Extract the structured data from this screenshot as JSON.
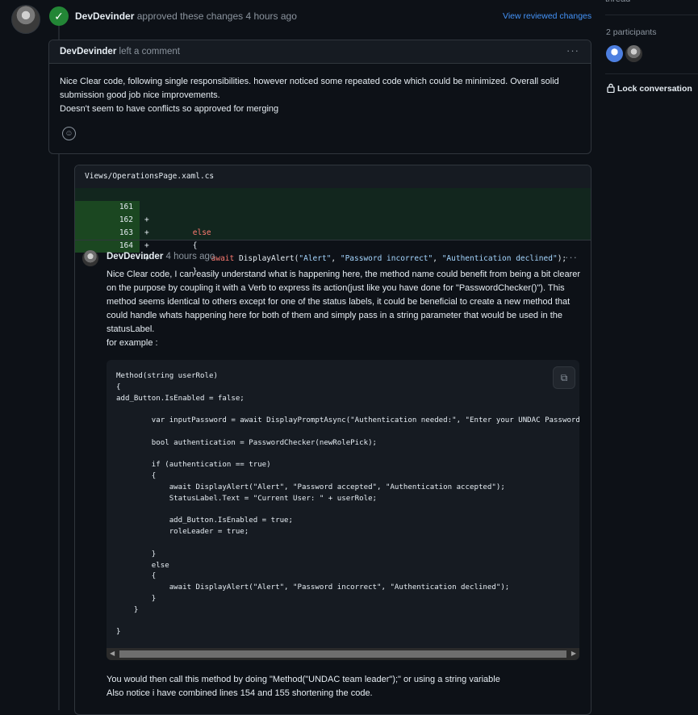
{
  "event": {
    "author": "DevDevinder",
    "action": "approved these changes",
    "time": "4 hours ago",
    "view_reviewed": "View reviewed changes"
  },
  "sidebar": {
    "top_cut_text": "thread",
    "participants_label": "2 participants",
    "lock_label": "Lock conversation"
  },
  "review": {
    "author": "DevDevinder",
    "action": "left a comment",
    "body": [
      "Nice Clear code, following single responsibilities. however noticed some repeated code which could be minimized. Overall solid submission good job nice improvements.",
      "Doesn't seem to have conflicts so approved for merging"
    ]
  },
  "file": {
    "path": "Views/OperationsPage.xaml.cs",
    "lines": [
      {
        "num": "161",
        "sign": "+",
        "indent": "        ",
        "kw": "else",
        "rest": ""
      },
      {
        "num": "162",
        "sign": "+",
        "indent": "        ",
        "kw": "",
        "rest": "{"
      },
      {
        "num": "163",
        "sign": "+",
        "indent": "            ",
        "kw": "await",
        "fn": "DisplayAlert",
        "args": [
          "\"Alert\"",
          "\"Password incorrect\"",
          "\"Authentication declined\""
        ]
      },
      {
        "num": "164",
        "sign": "+",
        "indent": "        ",
        "kw": "",
        "rest": "}"
      }
    ]
  },
  "thread_comment": {
    "author": "DevDevinder",
    "time": "4 hours ago",
    "body": [
      "Nice Clear code, I can easily understand what is happening here, the method name could benefit from being a bit clearer on the purpose by coupling it with a Verb to express its action(just like you have done for \"PasswordChecker()\"). This method seems identical to others except for one of the status labels, it could be beneficial to create a new method that could handle whats happening here for both of them and simply pass in a string parameter that would be used in the statusLabel.",
      "for example :"
    ],
    "code": "Method(string userRole)\n{\nadd_Button.IsEnabled = false;\n\n        var inputPassword = await DisplayPromptAsync(\"Authentication needed:\", \"Enter your UNDAC Password:\");\n\n        bool authentication = PasswordChecker(newRolePick);\n\n        if (authentication == true)\n        {\n            await DisplayAlert(\"Alert\", \"Password accepted\", \"Authentication accepted\");\n            StatusLabel.Text = \"Current User: \" + userRole;\n\n            add_Button.IsEnabled = true;\n            roleLeader = true;\n\n        }\n        else\n        {\n            await DisplayAlert(\"Alert\", \"Password incorrect\", \"Authentication declined\");\n        }\n    }\n\n}",
    "footer": [
      "You would then call this method by doing \"Method(\"UNDAC team leader\");\" or using a string variable",
      "Also notice i have combined lines 154 and 155 shortening the code."
    ]
  }
}
